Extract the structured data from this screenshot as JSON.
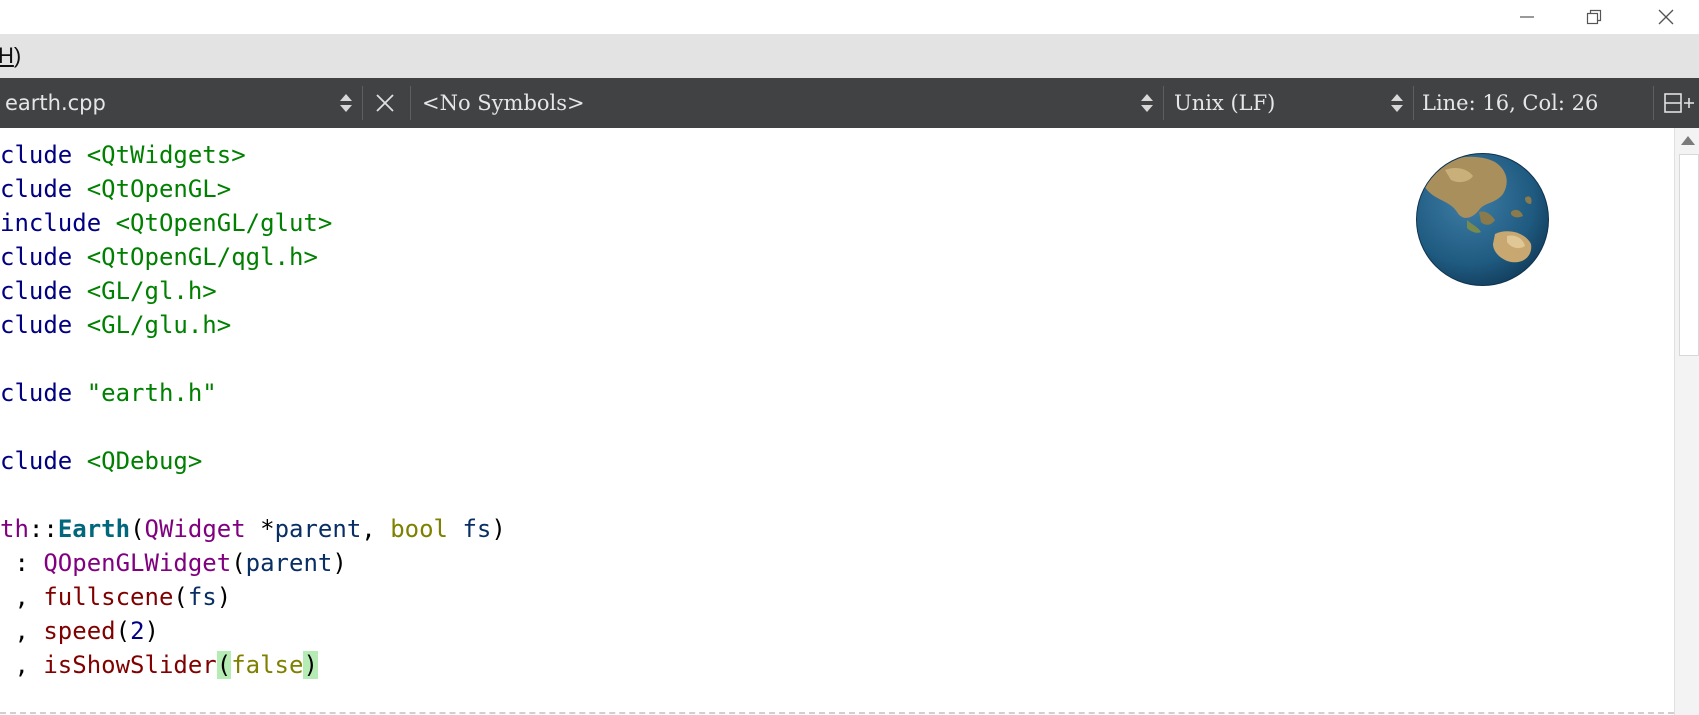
{
  "window": {
    "minimize_glyph": "—",
    "restore_glyph": "❐",
    "close_glyph": "✕"
  },
  "menubar": {
    "partial_item_prefix": "",
    "partial_item_key": "H",
    "partial_item_suffix": ")"
  },
  "toolbar": {
    "file_name": "earth.cpp",
    "close_glyph": "✕",
    "symbols": "<No Symbols>",
    "line_ending": "Unix (LF)",
    "cursor_position": "Line: 16, Col: 26",
    "split_glyph": "⊟+"
  },
  "code_lines": [
    [
      {
        "t": "clude ",
        "c": "kw-dir"
      },
      {
        "t": "<QtWidgets>",
        "c": "str"
      }
    ],
    [
      {
        "t": "clude ",
        "c": "kw-dir"
      },
      {
        "t": "<QtOpenGL>",
        "c": "str"
      }
    ],
    [
      {
        "t": "include ",
        "c": "kw-dir"
      },
      {
        "t": "<QtOpenGL/glut>",
        "c": "str"
      }
    ],
    [
      {
        "t": "clude ",
        "c": "kw-dir"
      },
      {
        "t": "<QtOpenGL/qgl.h>",
        "c": "str"
      }
    ],
    [
      {
        "t": "clude ",
        "c": "kw-dir"
      },
      {
        "t": "<GL/gl.h>",
        "c": "str"
      }
    ],
    [
      {
        "t": "clude ",
        "c": "kw-dir"
      },
      {
        "t": "<GL/glu.h>",
        "c": "str"
      }
    ],
    [],
    [
      {
        "t": "clude ",
        "c": "kw-dir"
      },
      {
        "t": "\"earth.h\"",
        "c": "str"
      }
    ],
    [],
    [
      {
        "t": "clude ",
        "c": "kw-dir"
      },
      {
        "t": "<QDebug>",
        "c": "str"
      }
    ],
    [],
    [
      {
        "t": "th",
        "c": "cls"
      },
      {
        "t": "::",
        "c": ""
      },
      {
        "t": "Earth",
        "c": "func"
      },
      {
        "t": "(",
        "c": ""
      },
      {
        "t": "QWidget",
        "c": "cls"
      },
      {
        "t": " *",
        "c": ""
      },
      {
        "t": "parent",
        "c": "var"
      },
      {
        "t": ", ",
        "c": ""
      },
      {
        "t": "bool",
        "c": "kw"
      },
      {
        "t": " ",
        "c": ""
      },
      {
        "t": "fs",
        "c": "var"
      },
      {
        "t": ")",
        "c": ""
      }
    ],
    [
      {
        "t": " : ",
        "c": ""
      },
      {
        "t": "QOpenGLWidget",
        "c": "cls"
      },
      {
        "t": "(",
        "c": ""
      },
      {
        "t": "parent",
        "c": "var"
      },
      {
        "t": ")",
        "c": ""
      }
    ],
    [
      {
        "t": " , ",
        "c": ""
      },
      {
        "t": "fullscene",
        "c": "member"
      },
      {
        "t": "(",
        "c": ""
      },
      {
        "t": "fs",
        "c": "var"
      },
      {
        "t": ")",
        "c": ""
      }
    ],
    [
      {
        "t": " , ",
        "c": ""
      },
      {
        "t": "speed",
        "c": "member"
      },
      {
        "t": "(",
        "c": ""
      },
      {
        "t": "2",
        "c": "num"
      },
      {
        "t": ")",
        "c": ""
      }
    ],
    [
      {
        "t": " , ",
        "c": ""
      },
      {
        "t": "isShowSlider",
        "c": "member"
      },
      {
        "t": "(",
        "c": "paren-hl"
      },
      {
        "t": "false",
        "c": "kw"
      },
      {
        "t": ")",
        "c": "paren-hl"
      }
    ]
  ]
}
